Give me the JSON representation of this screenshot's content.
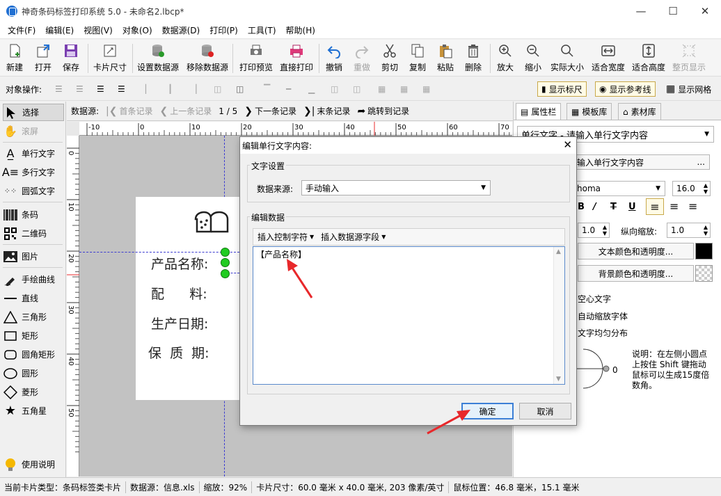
{
  "window": {
    "title": "神奇条码标签打印系统 5.0 - 未命名2.lbcp*"
  },
  "menu": [
    "文件(F)",
    "编辑(E)",
    "视图(V)",
    "对象(O)",
    "数据源(D)",
    "打印(P)",
    "工具(T)",
    "帮助(H)"
  ],
  "toolbar": {
    "new": "新建",
    "open": "打开",
    "save": "保存",
    "card_size": "卡片尺寸",
    "set_datasource": "设置数据源",
    "remove_datasource": "移除数据源",
    "print_preview": "打印预览",
    "direct_print": "直接打印",
    "undo": "撤销",
    "redo": "重做",
    "cut": "剪切",
    "copy": "复制",
    "paste": "粘贴",
    "delete": "删除",
    "zoom_in": "放大",
    "zoom_out": "缩小",
    "actual_size": "实际大小",
    "fit_width": "适合宽度",
    "fit_height": "适合高度",
    "fit_page": "整页显示"
  },
  "objbar": {
    "label": "对象操作:",
    "show_ruler": "显示标尺",
    "show_guides": "显示参考线",
    "show_grid": "显示网格"
  },
  "tools": {
    "select": "选择",
    "scroll": "滚屏",
    "single_text": "单行文字",
    "multi_text": "多行文字",
    "arc_text": "圆弧文字",
    "barcode": "条码",
    "qrcode": "二维码",
    "image": "图片",
    "freehand": "手绘曲线",
    "line": "直线",
    "triangle": "三角形",
    "rectangle": "矩形",
    "round_rect": "圆角矩形",
    "circle": "圆形",
    "diamond": "菱形",
    "star": "五角星",
    "help": "使用说明"
  },
  "navbar": {
    "label": "数据源:",
    "first": "首条记录",
    "prev": "上一条记录",
    "position": "1 / 5",
    "next": "下一条记录",
    "last": "末条记录",
    "jump": "跳转到记录"
  },
  "ruler": {
    "h_ticks": [
      "-10",
      "0",
      "10",
      "20",
      "30",
      "40",
      "50",
      "60",
      "70"
    ],
    "v_ticks": [
      "0",
      "10",
      "20",
      "30",
      "40",
      "50"
    ]
  },
  "card": {
    "product_name": "产品名称:",
    "ingredients": "配      料:",
    "production_date": "生产日期:",
    "shelf_life": "保  质  期:"
  },
  "rightpanel": {
    "tabs": [
      "属性栏",
      "模板库",
      "素材库"
    ],
    "object_select": "单行文字 - 请输入单行文字内容",
    "content_button": "输入单行文字内容",
    "font_name": "homa",
    "font_size": "16.0",
    "hscale_value": "1.0",
    "vscale_label": "纵向缩放:",
    "vscale_value": "1.0",
    "text_color": "文本颜色和透明度...",
    "bg_color": "背景颜色和透明度...",
    "hollow": "空心文字",
    "autoscale": "自动缩放字体",
    "distribute": "文字均匀分布",
    "angle": "0",
    "note": "说明：在左侧小圆点上按住 Shift 键拖动鼠标可以生成15度倍数角。",
    "text_color_hex": "#000000"
  },
  "dialog": {
    "title": "编辑单行文字内容:",
    "group1": "文字设置",
    "datasource_label": "数据来源:",
    "datasource_value": "手动输入",
    "group2": "编辑数据",
    "insert_control": "插入控制字符",
    "insert_field": "插入数据源字段",
    "content": "【产品名称】",
    "ok": "确定",
    "cancel": "取消"
  },
  "status": {
    "card_type": "当前卡片类型：条码标签类卡片",
    "datasource": "数据源：信息.xls",
    "zoom": "缩放：92%",
    "card_size": "卡片尺寸：60.0 毫米 x 40.0 毫米, 203 像素/英寸",
    "mouse_pos": "鼠标位置：46.8 毫米，15.1 毫米"
  },
  "colors": {
    "accent": "#3c7fd6",
    "annotation_arrow": "#e8282b",
    "handle": "#22cc22"
  }
}
